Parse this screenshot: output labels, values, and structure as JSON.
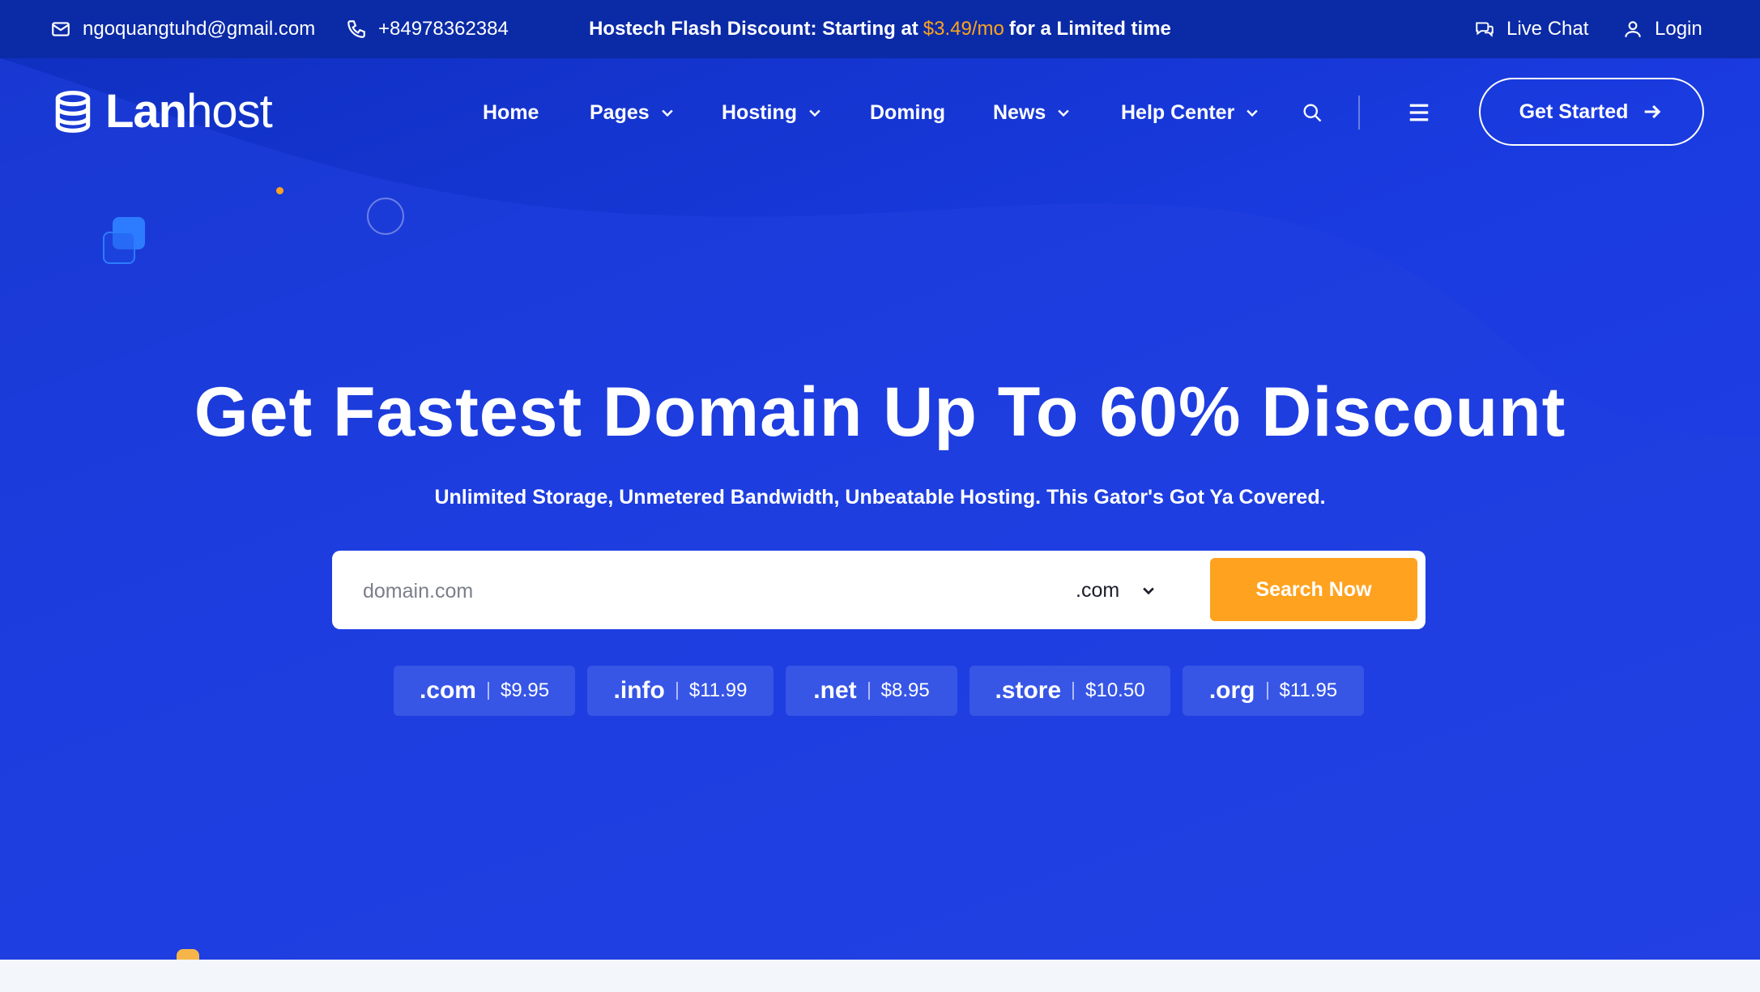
{
  "topbar": {
    "email": "ngoquangtuhd@gmail.com",
    "phone": "+84978362384",
    "promo_prefix": "Hostech Flash Discount: Starting at",
    "promo_price": "$3.49/mo",
    "promo_suffix": "for a Limited time",
    "live_chat": "Live Chat",
    "login": "Login"
  },
  "logo": {
    "bold": "Lan",
    "light": "host"
  },
  "nav": {
    "items": [
      {
        "label": "Home",
        "dropdown": false
      },
      {
        "label": "Pages",
        "dropdown": true
      },
      {
        "label": "Hosting",
        "dropdown": true
      },
      {
        "label": "Doming",
        "dropdown": false
      },
      {
        "label": "News",
        "dropdown": true
      },
      {
        "label": "Help Center",
        "dropdown": true
      }
    ],
    "cta": "Get Started"
  },
  "hero": {
    "headline": "Get Fastest Domain Up To 60% Discount",
    "subline": "Unlimited Storage, Unmetered Bandwidth, Unbeatable Hosting. This Gator's Got Ya Covered."
  },
  "search": {
    "placeholder": "domain.com",
    "tld_selected": ".com",
    "button": "Search Now"
  },
  "tlds": [
    {
      "name": ".com",
      "price": "$9.95"
    },
    {
      "name": ".info",
      "price": "$11.99"
    },
    {
      "name": ".net",
      "price": "$8.95"
    },
    {
      "name": ".store",
      "price": "$10.50"
    },
    {
      "name": ".org",
      "price": "$11.95"
    }
  ],
  "colors": {
    "accent": "#ffa21f",
    "primary": "#1a3be0",
    "topbar": "#0b2aa6"
  }
}
